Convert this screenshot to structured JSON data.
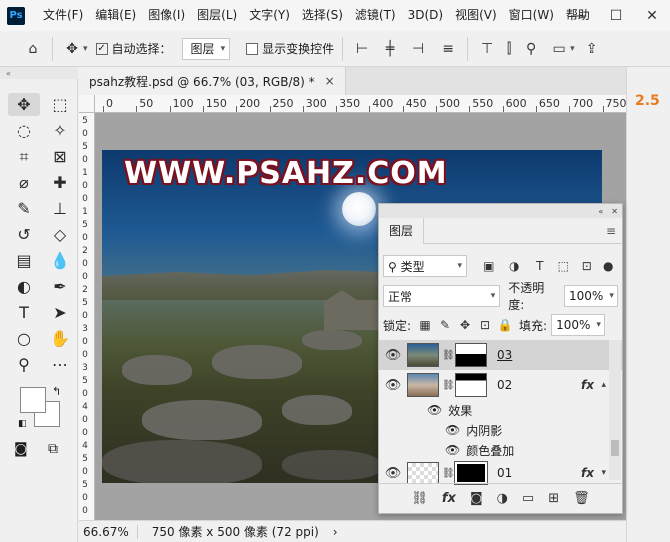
{
  "menu": {
    "logo": "Ps",
    "items": [
      "文件(F)",
      "编辑(E)",
      "图像(I)",
      "图层(L)",
      "文字(Y)",
      "选择(S)",
      "滤镜(T)",
      "3D(D)",
      "视图(V)",
      "窗口(W)",
      "帮助"
    ]
  },
  "options": {
    "auto_select_label": "自动选择：",
    "auto_select_value": "图层",
    "show_transform_label": "显示变换控件"
  },
  "document": {
    "tab_title": "psahz教程.psd @ 66.7% (03, RGB/8) *",
    "close": "×",
    "watermark": "WWW.PSAHZ.COM"
  },
  "ruler": {
    "h_ticks": [
      "0",
      "50",
      "100",
      "150",
      "200",
      "250",
      "300",
      "350",
      "400",
      "450",
      "500",
      "550",
      "600",
      "650",
      "700",
      "750"
    ],
    "v_ticks": [
      "5",
      "0",
      "5",
      "0",
      "1",
      "0",
      "0",
      "1",
      "5",
      "0",
      "2",
      "0",
      "0",
      "2",
      "5",
      "0",
      "3",
      "0",
      "0",
      "3",
      "5",
      "0",
      "4",
      "0",
      "0",
      "4",
      "5",
      "0",
      "5",
      "0",
      "0"
    ]
  },
  "status": {
    "zoom": "66.67%",
    "info": "750 像素 x 500 像素 (72 ppi)",
    "arrow": "›"
  },
  "right_panel": {
    "value": "2.5"
  },
  "layers_panel": {
    "tab": "图层",
    "filter_kind": "类型",
    "blend_mode": "正常",
    "opacity_label": "不透明度:",
    "opacity_value": "100%",
    "lock_label": "锁定:",
    "fill_label": "填充:",
    "fill_value": "100%",
    "layers": [
      {
        "name": "03",
        "selected": true
      },
      {
        "name": "02",
        "fx": "fx"
      },
      {
        "name": "01",
        "fx": "fx"
      }
    ],
    "effects_label": "效果",
    "effects": [
      "内阴影",
      "颜色叠加"
    ]
  }
}
